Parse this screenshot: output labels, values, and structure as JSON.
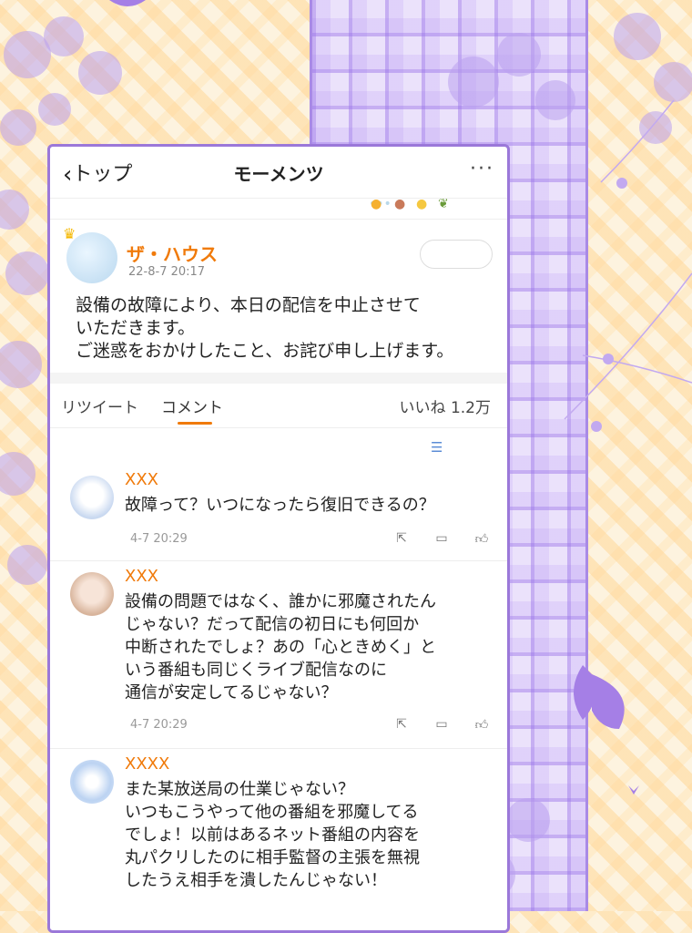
{
  "nav": {
    "back_label": "トップ",
    "title": "モーメンツ",
    "more_label": "···"
  },
  "post": {
    "author": "ザ・ハウス",
    "time": "22-8-7 20:17",
    "text_lines": [
      "設備の故障により、本日の配信を中止させて",
      "いただきます。",
      "ご迷惑をおかけしたこと、お詫び申し上げます。"
    ]
  },
  "tabs": {
    "retweet": "リツイート",
    "comment": "コメント",
    "likes": "いいね 1.2万"
  },
  "comments": [
    {
      "name": "XXX",
      "lines": [
        "故障って？いつになったら復旧できるの？"
      ],
      "time": "4-7 20:29"
    },
    {
      "name": "XXX",
      "lines": [
        "設備の問題ではなく、誰かに邪魔されたん",
        "じゃない？だって配信の初日にも何回か",
        "中断されたでしょ？あの「心ときめく」と",
        "いう番組も同じくライブ配信なのに",
        "通信が安定してるじゃない？"
      ],
      "time": "4-7 20:29"
    },
    {
      "name": "XXXX",
      "lines": [
        "また某放送局の仕業じゃない？",
        "いつもこうやって他の番組を邪魔してる",
        "でしょ！以前はあるネット番組の内容を",
        "丸パクリしたのに相手監督の主張を無視",
        "したうえ相手を潰したんじゃない！"
      ]
    }
  ],
  "icons": {
    "share": "share-icon",
    "comment": "comment-icon",
    "like": "like-icon",
    "sort": "sort-icon"
  },
  "colors": {
    "accent": "#f07a0a",
    "frame": "#9b78d9"
  }
}
